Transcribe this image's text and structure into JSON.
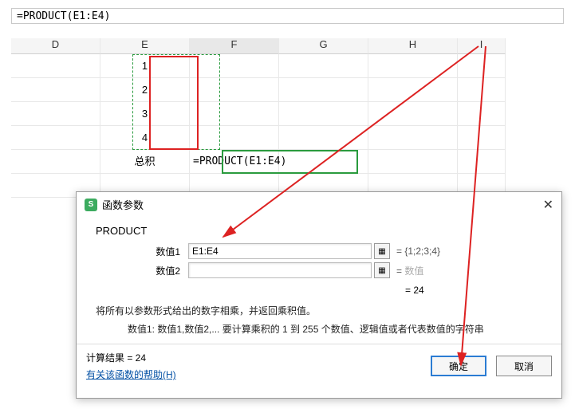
{
  "formula_bar": "=PRODUCT(E1:E4)",
  "columns": [
    "D",
    "E",
    "F",
    "G",
    "H",
    "I"
  ],
  "cells": {
    "e1": "1",
    "e2": "2",
    "e3": "3",
    "e4": "4",
    "e5": "总积",
    "f5": "=PRODUCT(E1:E4)"
  },
  "dialog": {
    "title": "函数参数",
    "function_name": "PRODUCT",
    "param1_label": "数值1",
    "param1_value": "E1:E4",
    "param1_result": "= {1;2;3;4}",
    "param2_label": "数值2",
    "param2_value": "",
    "param2_placeholder": "数值",
    "interim_result": "= 24",
    "description": "将所有以参数形式给出的数字相乘，并返回乘积值。",
    "param_desc": "数值1:  数值1,数值2,... 要计算乘积的 1 到 255 个数值、逻辑值或者代表数值的字符串",
    "calc_label": "计算结果 =  24",
    "help_link": "有关该函数的帮助(H)",
    "ok": "确定",
    "cancel": "取消"
  },
  "chart_data": {
    "type": "table",
    "title": "Excel PRODUCT function example",
    "range": "E1:E4",
    "values": [
      1,
      2,
      3,
      4
    ],
    "formula": "=PRODUCT(E1:E4)",
    "result": 24
  }
}
